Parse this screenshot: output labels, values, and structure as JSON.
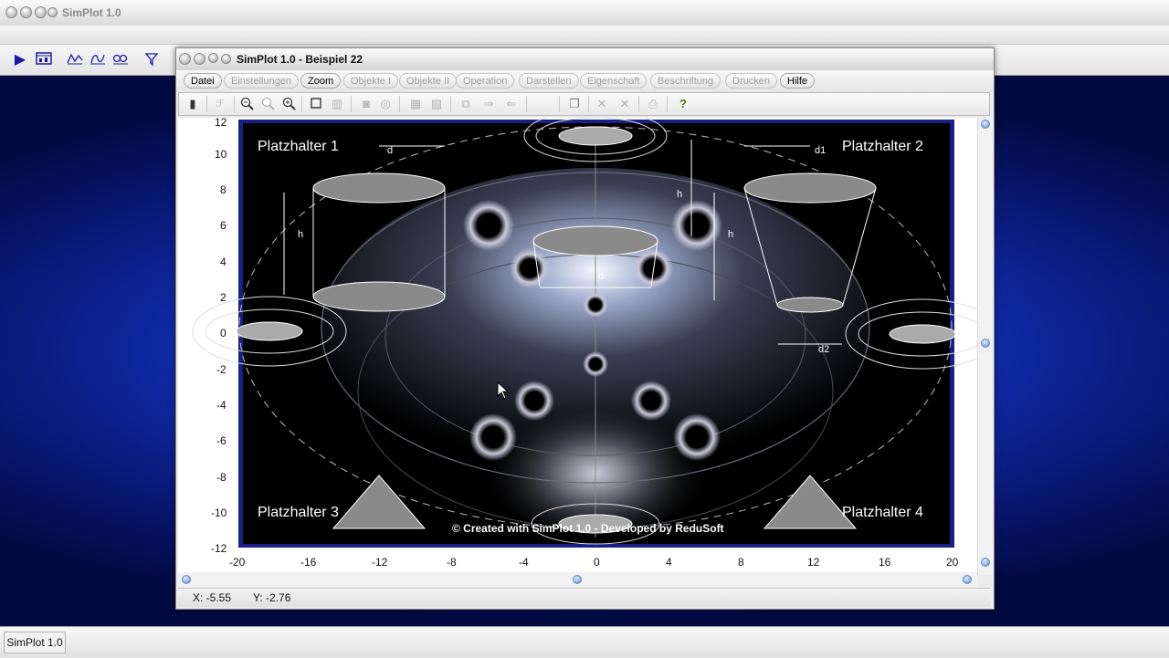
{
  "outer_window": {
    "title": "SimPlot 1.0"
  },
  "taskbar": {
    "item": "SimPlot 1.0"
  },
  "inner_window": {
    "title": "SimPlot 1.0 - Beispiel 22"
  },
  "menu": [
    {
      "label": "Datei",
      "active": true
    },
    {
      "label": "Einstellungen",
      "active": false
    },
    {
      "label": "Zoom",
      "active": true
    },
    {
      "label": "Objekte I",
      "active": false
    },
    {
      "label": "Objekte II",
      "active": false
    },
    {
      "label": "Operation",
      "active": false
    },
    {
      "label": "Darstellen",
      "active": false
    },
    {
      "label": "Eigenschaft",
      "active": false
    },
    {
      "label": "Beschriftung",
      "active": false
    },
    {
      "label": "Drucken",
      "active": false
    },
    {
      "label": "Hilfe",
      "active": true
    }
  ],
  "toolbar_icons": [
    "calculator-icon",
    "function-icon",
    "zoom-out-icon",
    "zoom-fit-icon",
    "zoom-in-icon",
    "rectangle-icon",
    "grid-icon",
    "circle-icon",
    "circle-outline-icon",
    "table-icon",
    "image-icon",
    "copy-object-icon",
    "arrow-right-icon",
    "arrow-left-icon",
    "pages-icon",
    "close-object-icon",
    "delete-icon",
    "print-icon",
    "help-icon"
  ],
  "outer_toolbar_icons": [
    "play-icon",
    "graph-window-icon",
    "line-chart-icon",
    "parametric-chart-icon",
    "polar-chart-icon",
    "funnel-icon"
  ],
  "plot": {
    "x_ticks": [
      "-20",
      "-16",
      "-12",
      "-8",
      "-4",
      "0",
      "4",
      "8",
      "12",
      "16",
      "20"
    ],
    "y_ticks": [
      "12",
      "10",
      "8",
      "6",
      "4",
      "2",
      "0",
      "-2",
      "-4",
      "-6",
      "-8",
      "-10",
      "-12"
    ],
    "xlim": [
      -20,
      20
    ],
    "ylim": [
      -12,
      12
    ],
    "placeholders": {
      "tl": "Platzhalter 1",
      "tr": "Platzhalter 2",
      "bl": "Platzhalter 3",
      "br": "Platzhalter 4"
    },
    "credit": "© Created with SimPlot 1.0 - Developed by ReduSoft",
    "dim_labels": {
      "d": "d",
      "d1": "d1",
      "d2": "d2",
      "h": "h"
    }
  },
  "coords": {
    "x": "X: -5.55",
    "y": "Y: -2.76"
  }
}
